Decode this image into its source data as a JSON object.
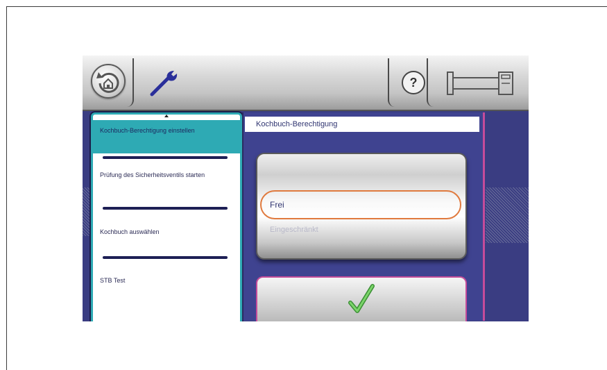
{
  "menu": {
    "items": [
      {
        "label": "Kochbuch-Berechtigung einstellen"
      },
      {
        "label": "Prüfung des Sicherheitsventils starten"
      },
      {
        "label": "Kochbuch auswählen"
      },
      {
        "label": "STB Test"
      }
    ]
  },
  "panel": {
    "title": "Kochbuch-Berechtigung",
    "options": {
      "selected": "Frei",
      "other": "Eingeschränkt"
    }
  },
  "topbar": {
    "help_label": "?"
  },
  "colors": {
    "accent": "#2eaab4",
    "highlight_border": "#e07a3e",
    "check": "#5ab84a",
    "panel_border": "#c54c9a"
  },
  "icons": {
    "home": "home-back-icon",
    "wrench": "wrench-icon",
    "help": "help-icon",
    "machine": "machine-icon",
    "check": "checkmark-icon"
  }
}
